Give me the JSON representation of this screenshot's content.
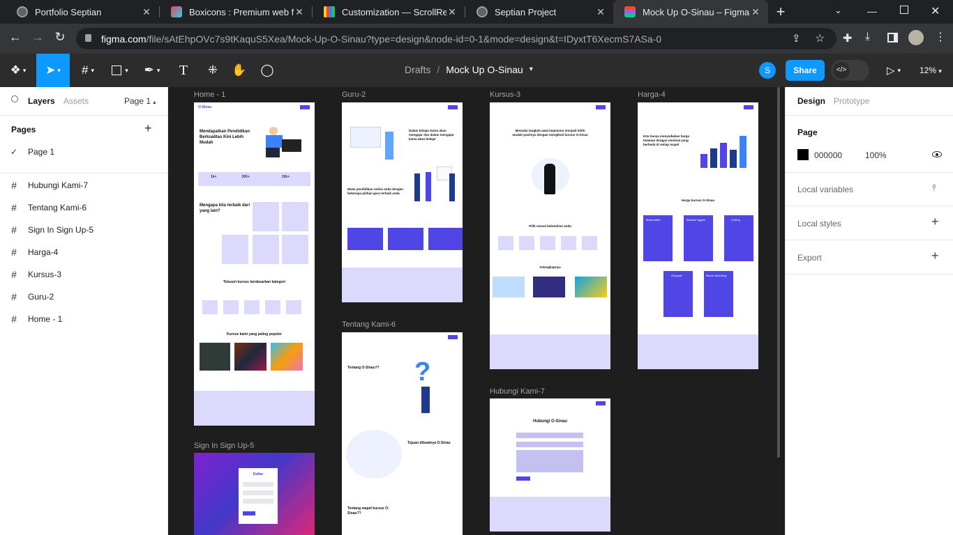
{
  "browser": {
    "tabs": [
      {
        "title": "Portfolio Septian"
      },
      {
        "title": "Boxicons : Premium web frien"
      },
      {
        "title": "Customization — ScrollReveal"
      },
      {
        "title": "Septian Project"
      },
      {
        "title": "Mock Up O-Sinau – Figma"
      }
    ],
    "url_host": "figma.com",
    "url_rest": "/file/sAtEhpOVc7s9tKaquS5Xea/Mock-Up-O-Sinau?type=design&node-id=0-1&mode=design&t=IDyxtT6XecmS7ASa-0"
  },
  "toolbar": {
    "breadcrumb_drafts": "Drafts",
    "breadcrumb_sep": "/",
    "file_name": "Mock Up O-Sinau",
    "avatar_letter": "S",
    "share_label": "Share",
    "zoom": "12%"
  },
  "left_panel": {
    "tab_layers": "Layers",
    "tab_assets": "Assets",
    "page_selector": "Page 1",
    "pages_title": "Pages",
    "current_page": "Page 1",
    "layers": [
      "Hubungi Kami-7",
      "Tentang Kami-6",
      "Sign In Sign Up-5",
      "Harga-4",
      "Kursus-3",
      "Guru-2",
      "Home - 1"
    ]
  },
  "right_panel": {
    "tab_design": "Design",
    "tab_prototype": "Prototype",
    "page_label": "Page",
    "fill_hex": "000000",
    "fill_opacity": "100%",
    "local_variables": "Local variables",
    "local_styles": "Local styles",
    "export": "Export"
  },
  "canvas": {
    "frames": {
      "home": "Home - 1",
      "guru": "Guru-2",
      "kursus": "Kursus-3",
      "harga": "Harga-4",
      "tentang": "Tentang Kami-6",
      "hubungi": "Hubungi Kami-7",
      "signin": "Sign In Sign Up-5"
    },
    "home_text": {
      "logo": "O-Sinau",
      "hero": "Mendapatkan Pendidikan Berkualitas Kini Lebih Mudah",
      "stat1": "1k+",
      "stat2": "300+",
      "stat3": "10k+",
      "why": "Mengapa kita terbaik dari yang lain?",
      "cats": "Telusuri kursus berdasarkan kategori",
      "popular": "Kursus kami yang paling populer"
    },
    "guru_text": {
      "a": "Dalam belajar kamu akan mengajar dan dalam mengajar kamu akan belajar",
      "b": "Mulai pendidikan online anda dengan beberapa pilihan guru terbaik anda"
    },
    "kursus_text": {
      "a": "Memulai langkah awal impianmu menjadi lebih mudah pastinya dengan mengikuti kursus O-Sinau",
      "b": "Pilih sesuai kebutuhan anda",
      "c": "Selengkapnya"
    },
    "harga_text": {
      "a": "Kita hanya menyediakan harga bulanan dengan nominal yang berbeda di setiap mapel",
      "b": "Harga kursus O-Sinau",
      "plans": [
        "Matematika",
        "Bahasa Inggris",
        "Coding",
        "Geografi",
        "Bisnis Marketing"
      ]
    },
    "tentang_text": {
      "a": "Tentang O-Sinau??",
      "b": "Tujuan dibuatnya O-Sinau",
      "c": "Tentang mapel kursus O-Sinau??"
    },
    "hubungi_text": {
      "a": "Hubungi O-Sinau"
    },
    "signin_text": {
      "a": "Daftar"
    }
  },
  "help_label": "?"
}
